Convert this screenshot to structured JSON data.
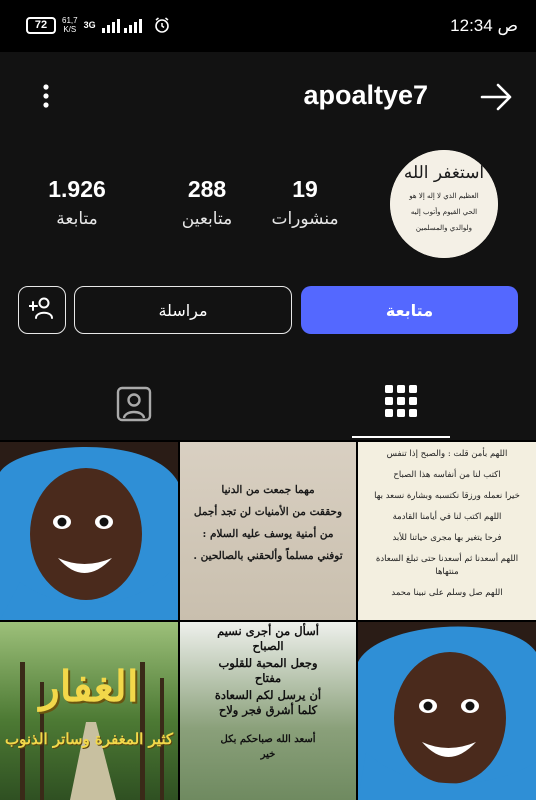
{
  "status_bar": {
    "time": "12:34 ص",
    "battery": "72",
    "net_speed_value": "61,7",
    "net_speed_unit": "K/S",
    "network_type": "3G"
  },
  "header": {
    "username": "apoaltye7"
  },
  "profile": {
    "stats": {
      "posts_count": "19",
      "posts_label": "منشورات",
      "followers_count": "288",
      "followers_label": "متابعين",
      "following_count": "1.926",
      "following_label": "متابعة"
    },
    "avatar_text": {
      "title": "استغفر الله",
      "line1": "العظيم الذي لا إله إلا هو",
      "line2": "الحي القيوم وأتوب إليه",
      "line3": "ولوالدي والمسلمين"
    }
  },
  "buttons": {
    "follow": "متابعة",
    "message": "مراسلة"
  },
  "grid": {
    "post_top_right": [
      "اللهم بأمن قلت : والصبح إذا تنفس",
      "اكتب لنا من أنفاسه هذا الصباح",
      "خيرا نعمله ورزقا نكتسبه وبشارة نسعد بها",
      "اللهم اكتب لنا في أيامنا القادمة",
      "فرحا يتغير بها مجرى حياتنا للأبد",
      "اللهم أسعدنا ثم أسعدنا حتى تبلغ السعادة منتهاها",
      "اللهم صل وسلم على نبينا محمد"
    ],
    "post_top_middle": [
      "مهما جمعت من الدنيا",
      "وحققت من الأمنيات لن تجد أجمل",
      "من أمنية يوسف عليه السلام :",
      "توفني مسلماً وألحقني بالصالحين ."
    ],
    "post_bottom_middle": [
      "أسأل من أجرى نسيم",
      "الصباح",
      "وجعل المحبة للقلوب",
      "مفتاح",
      "أن يرسل لكم السعادة",
      "كلما أشرق فجر ولاح",
      "أسعد الله صباحكم بكل",
      "خير"
    ],
    "post_bottom_left_title": "الغفار",
    "post_bottom_left_subtitle": "كثير المغفرة وساتر الذنوب"
  },
  "colors": {
    "follow_button": "#5468ff",
    "background": "#121212"
  }
}
